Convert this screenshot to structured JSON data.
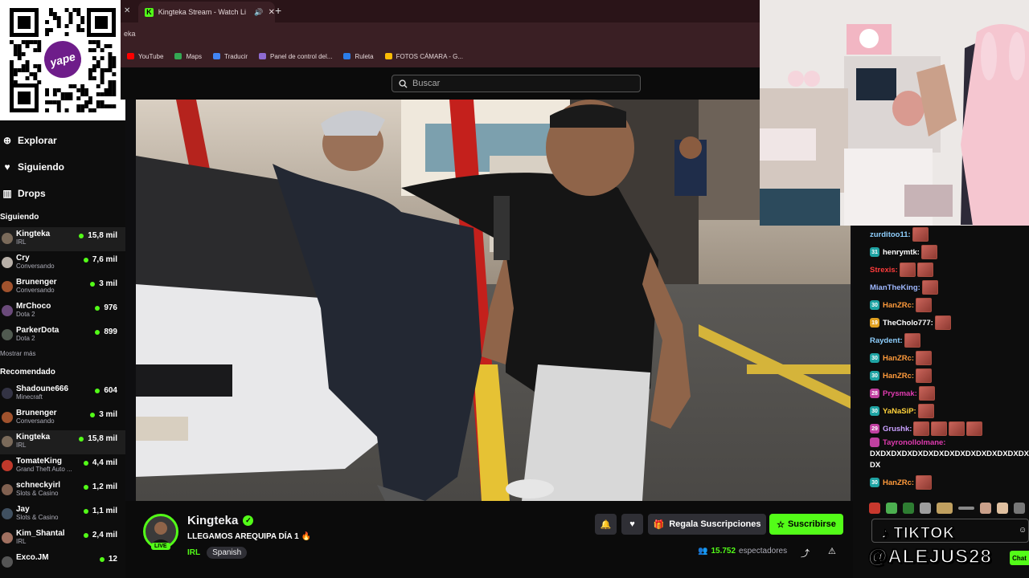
{
  "browser": {
    "tab_title": "Kingteka Stream - Watch Li",
    "url_fragment": "eka",
    "bookmarks": [
      {
        "label": "YouTube",
        "color": "#ff0000"
      },
      {
        "label": "Maps",
        "color": "#34a853"
      },
      {
        "label": "Traducir",
        "color": "#4285f4"
      },
      {
        "label": "Panel de control del...",
        "color": "#8e6bd1"
      },
      {
        "label": "Ruleta",
        "color": "#2b7de9"
      },
      {
        "label": "FOTOS CÁMARA - G...",
        "color": "#fbbc05"
      }
    ]
  },
  "header": {
    "search_placeholder": "Buscar"
  },
  "qr": {
    "logo_text": "yape"
  },
  "sidebar": {
    "nav": [
      {
        "label": "Explorar",
        "icon": "compass-icon"
      },
      {
        "label": "Siguiendo",
        "icon": "heart-icon"
      },
      {
        "label": "Drops",
        "icon": "drops-icon"
      }
    ],
    "following_title": "Siguiendo",
    "following": [
      {
        "name": "Kingteka",
        "cat": "IRL",
        "viewers": "15,8 mil",
        "live": true,
        "color": "#7a6a5a"
      },
      {
        "name": "Cry",
        "cat": "Conversando",
        "viewers": "7,6 mil",
        "live": true,
        "color": "#b8b0a8"
      },
      {
        "name": "Brunenger",
        "cat": "Conversando",
        "viewers": "3 mil",
        "live": true,
        "color": "#a0522d"
      },
      {
        "name": "MrChoco",
        "cat": "Dota 2",
        "viewers": "976",
        "live": true,
        "color": "#6a4a7a"
      },
      {
        "name": "ParkerDota",
        "cat": "Dota 2",
        "viewers": "899",
        "live": true,
        "color": "#505a50"
      }
    ],
    "show_more": "Mostrar más",
    "recommended_title": "Recomendado",
    "recommended": [
      {
        "name": "Shadoune666",
        "cat": "Minecraft",
        "viewers": "604",
        "color": "#333344"
      },
      {
        "name": "Brunenger",
        "cat": "Conversando",
        "viewers": "3 mil",
        "color": "#a0522d"
      },
      {
        "name": "Kingteka",
        "cat": "IRL",
        "viewers": "15,8 mil",
        "color": "#7a6a5a"
      },
      {
        "name": "TomateKing",
        "cat": "Grand Theft Auto ...",
        "viewers": "4,4 mil",
        "color": "#c0392b"
      },
      {
        "name": "schneckyirl",
        "cat": "Slots & Casino",
        "viewers": "1,2 mil",
        "color": "#806050"
      },
      {
        "name": "Jay",
        "cat": "Slots & Casino",
        "viewers": "1,1 mil",
        "color": "#405060"
      },
      {
        "name": "Kim_Shantal",
        "cat": "IRL",
        "viewers": "2,4 mil",
        "color": "#a07060"
      },
      {
        "name": "Exco.JM",
        "cat": "",
        "viewers": "12",
        "color": "#555555"
      }
    ]
  },
  "stream": {
    "channel": "Kingteka",
    "live_label": "LIVE",
    "title": "LLEGAMOS AREQUIPA DÍA 1 🔥",
    "category": "IRL",
    "language": "Spanish",
    "gift_label": "Regala Suscripciones",
    "subscribe_label": "Suscribirse",
    "viewers": "15.752",
    "viewers_label": "espectadores"
  },
  "chat": {
    "messages": [
      {
        "user": "zurditoo11:",
        "color": "#8fd0ff",
        "badge": "",
        "emotes": 1
      },
      {
        "user": "henrymtk:",
        "color": "#ffffff",
        "badge": "31",
        "badge_color": "#1fa3a3",
        "emotes": 1
      },
      {
        "user": "Strexis:",
        "color": "#ff3b3b",
        "badge": "",
        "emotes": 2
      },
      {
        "user": "MianTheKing:",
        "color": "#9fb8ff",
        "badge": "",
        "emotes": 1
      },
      {
        "user": "HanZRc:",
        "color": "#ff9a3b",
        "badge": "30",
        "badge_color": "#1fa3a3",
        "emotes": 1
      },
      {
        "user": "TheCholo777:",
        "color": "#ffffff",
        "badge": "19",
        "badge_color": "#e0a020",
        "emotes": 1
      },
      {
        "user": "Raydent:",
        "color": "#8fd0ff",
        "badge": "",
        "emotes": 1
      },
      {
        "user": "HanZRc:",
        "color": "#ff9a3b",
        "badge": "30",
        "badge_color": "#1fa3a3",
        "emotes": 1
      },
      {
        "user": "HanZRc:",
        "color": "#ff9a3b",
        "badge": "30",
        "badge_color": "#1fa3a3",
        "emotes": 1
      },
      {
        "user": "Prysmak:",
        "color": "#e03bb0",
        "badge": "28",
        "badge_color": "#c040a0",
        "emotes": 1
      },
      {
        "user": "YaNaSiP:",
        "color": "#ffd23b",
        "badge": "30",
        "badge_color": "#1fa3a3",
        "emotes": 1
      },
      {
        "user": "Grushk:",
        "color": "#c9a0ff",
        "badge": "29",
        "badge_color": "#c040a0",
        "emotes": 4
      }
    ],
    "long_message_user": "Tayronollolmane:",
    "long_message_text": "DXDXDXDXDXDXDXDXDXDXDXDXDXDXDXDX DX",
    "last_message_user": "HanZRc:",
    "tiktok_label": "TIKTOK",
    "tiktok_handle": "@ALEJUS28",
    "chat_button": "Chat"
  }
}
